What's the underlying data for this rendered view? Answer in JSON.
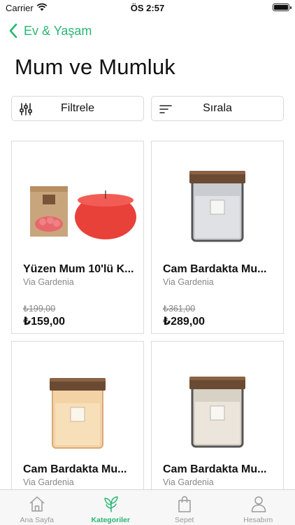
{
  "status_bar": {
    "carrier": "Carrier",
    "time": "ÖS 2:57"
  },
  "nav": {
    "back_label": "Ev & Yaşam"
  },
  "page_title": "Mum ve Mumluk",
  "toolbar": {
    "filter_label": "Filtrele",
    "sort_label": "Sırala"
  },
  "products": [
    {
      "name": "Yüzen Mum 10'lü K...",
      "brand": "Via Gardenia",
      "old_price": "₺199,00",
      "price": "₺159,00",
      "image": "floating-candle-image"
    },
    {
      "name": "Cam Bardakta Mu...",
      "brand": "Via Gardenia",
      "old_price": "₺361,00",
      "price": "₺289,00",
      "image": "jar-candle-gray-image"
    },
    {
      "name": "Cam Bardakta Mu...",
      "brand": "Via Gardenia",
      "old_price": "",
      "price": "",
      "image": "jar-candle-peach-image"
    },
    {
      "name": "Cam Bardakta Mu...",
      "brand": "Via Gardenia",
      "old_price": "",
      "price": "",
      "image": "jar-candle-beige-image"
    }
  ],
  "tabbar": {
    "items": [
      {
        "label": "Ana Sayfa",
        "icon": "home-icon",
        "active": false
      },
      {
        "label": "Kategoriler",
        "icon": "leaf-icon",
        "active": true
      },
      {
        "label": "Sepet",
        "icon": "bag-icon",
        "active": false
      },
      {
        "label": "Hesabım",
        "icon": "person-icon",
        "active": false
      }
    ]
  },
  "colors": {
    "accent": "#2ab673",
    "muted_text": "#888888",
    "border": "#dcdcdc"
  }
}
